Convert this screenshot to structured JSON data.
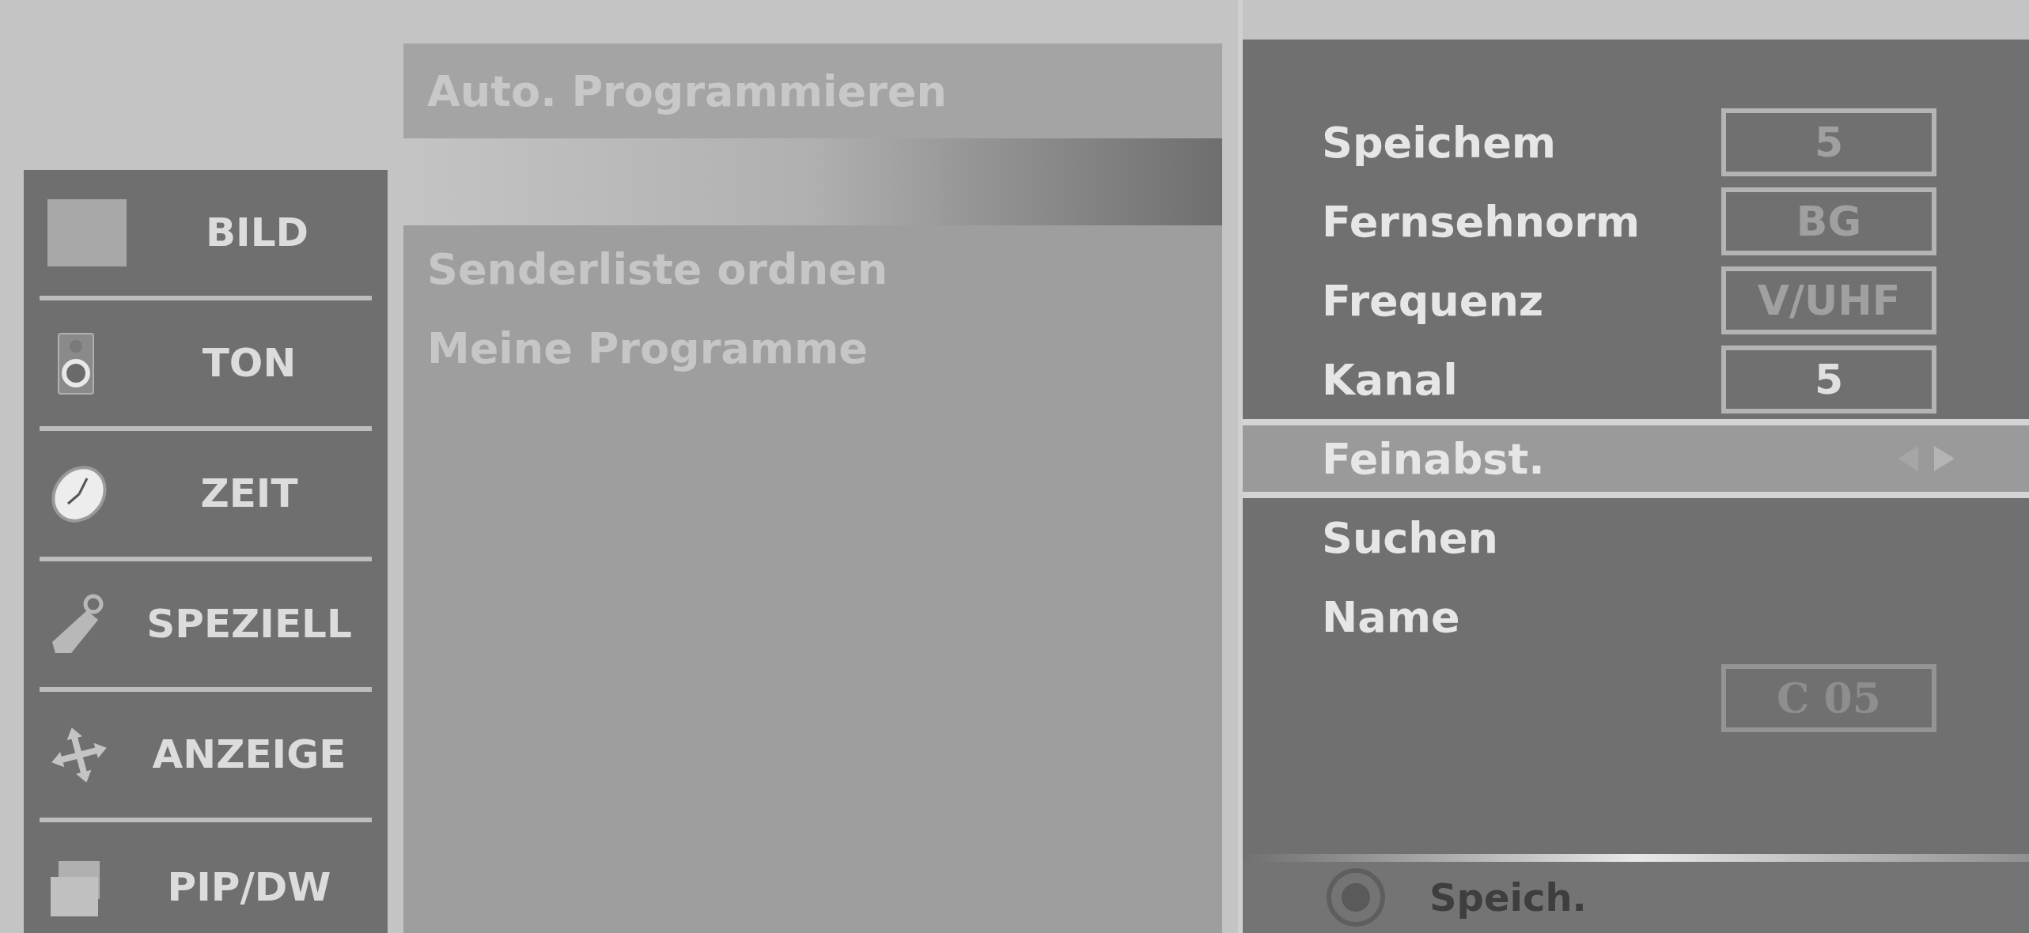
{
  "menu": [
    {
      "label": "BILD",
      "kind": "picture"
    },
    {
      "label": "TON",
      "kind": "sound"
    },
    {
      "label": "ZEIT",
      "kind": "time"
    },
    {
      "label": "SPEZIELL",
      "kind": "tag"
    },
    {
      "label": "ANZEIGE",
      "kind": "move"
    },
    {
      "label": "PIP/DW",
      "kind": "pip"
    }
  ],
  "submenu": {
    "title": "Auto. Programmieren",
    "items": [
      "Senderliste ordnen",
      "Meine Programme"
    ]
  },
  "settings": [
    {
      "label": "Speichem",
      "value": "5",
      "selected": false
    },
    {
      "label": "Fernsehnorm",
      "value": "BG",
      "selected": false
    },
    {
      "label": "Frequenz",
      "value": "V/UHF",
      "selected": false
    },
    {
      "label": "Kanal",
      "value": "5",
      "selected": false
    },
    {
      "label": "Feinabst.",
      "selected": true
    },
    {
      "label": "Suchen",
      "selected": false
    },
    {
      "label": "Name",
      "selected": false
    }
  ],
  "name_value": "C 05",
  "footer": {
    "label": "Speich."
  }
}
